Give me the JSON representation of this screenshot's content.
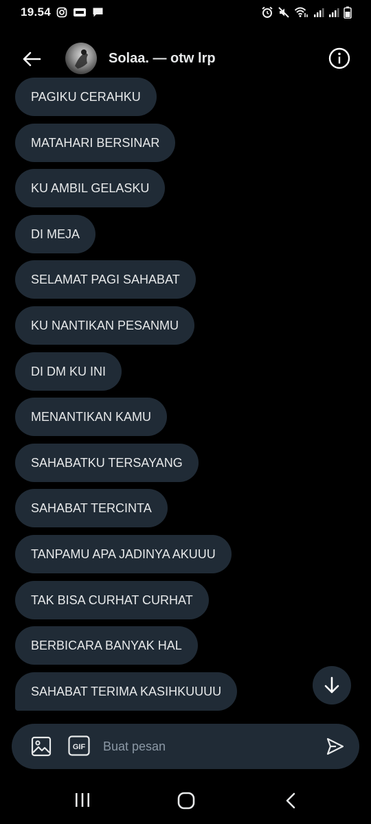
{
  "status_bar": {
    "time": "19.54",
    "left_icons": [
      "instagram-icon",
      "news-app-icon",
      "message-icon"
    ],
    "right_icons": [
      "alarm-icon",
      "mute-icon",
      "wifi-icon",
      "signal-icon",
      "signal-icon",
      "battery-icon"
    ]
  },
  "header": {
    "title": "Solaa. — otw lrp",
    "back_icon": "arrow-left-icon",
    "info_icon": "info-icon"
  },
  "messages": [
    "PAGIKU CERAHKU",
    "MATAHARI BERSINAR",
    "KU AMBIL GELASKU",
    "DI MEJA",
    "SELAMAT PAGI SAHABAT",
    "KU NANTIKAN PESANMU",
    "DI DM KU INI",
    "MENANTIKAN KAMU",
    "SAHABATKU TERSAYANG",
    "SAHABAT TERCINTA",
    "TANPAMU APA JADINYA AKUUU",
    "TAK BISA CURHAT CURHAT",
    "BERBICARA BANYAK HAL",
    "SAHABAT TERIMA KASIHKUUUU"
  ],
  "composer": {
    "placeholder": "Buat pesan",
    "gif_label": "GIF"
  },
  "colors": {
    "background": "#000000",
    "bubble": "#202b36",
    "text": "#e7e9ea",
    "placeholder": "#8b98a5"
  }
}
